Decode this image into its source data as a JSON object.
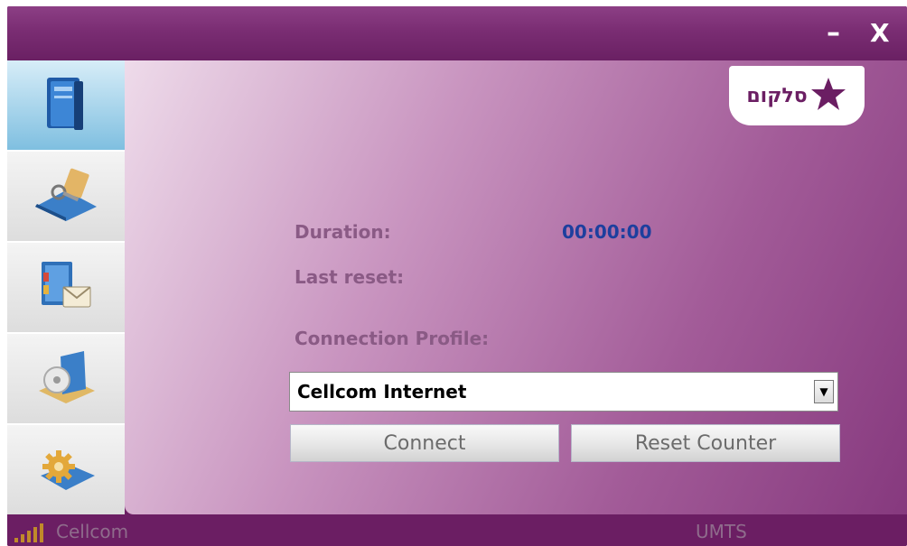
{
  "window": {
    "minimize_label": "–",
    "close_label": "X"
  },
  "sidebar": {
    "items": [
      {
        "icon": "book-icon",
        "active": true
      },
      {
        "icon": "folder-key-icon",
        "active": false
      },
      {
        "icon": "contacts-mail-icon",
        "active": false
      },
      {
        "icon": "disk-folder-icon",
        "active": false
      },
      {
        "icon": "settings-gear-icon",
        "active": false
      }
    ]
  },
  "brand": {
    "logo_text": "סלקום",
    "color": "#6b1e63"
  },
  "stats": {
    "duration_label": "Duration:",
    "duration_value": "00:00:00",
    "last_reset_label": "Last reset:",
    "last_reset_value": ""
  },
  "profile": {
    "label": "Connection Profile:",
    "selected": "Cellcom Internet",
    "arrow": "▼"
  },
  "buttons": {
    "connect": "Connect",
    "reset_counter": "Reset Counter"
  },
  "status": {
    "carrier": "Cellcom",
    "network": "UMTS",
    "signal_icon": "signal-bars-icon"
  },
  "colors": {
    "accent": "#6b1e63",
    "value_blue": "#1d3f9e",
    "label_muted": "#8a5a85"
  }
}
